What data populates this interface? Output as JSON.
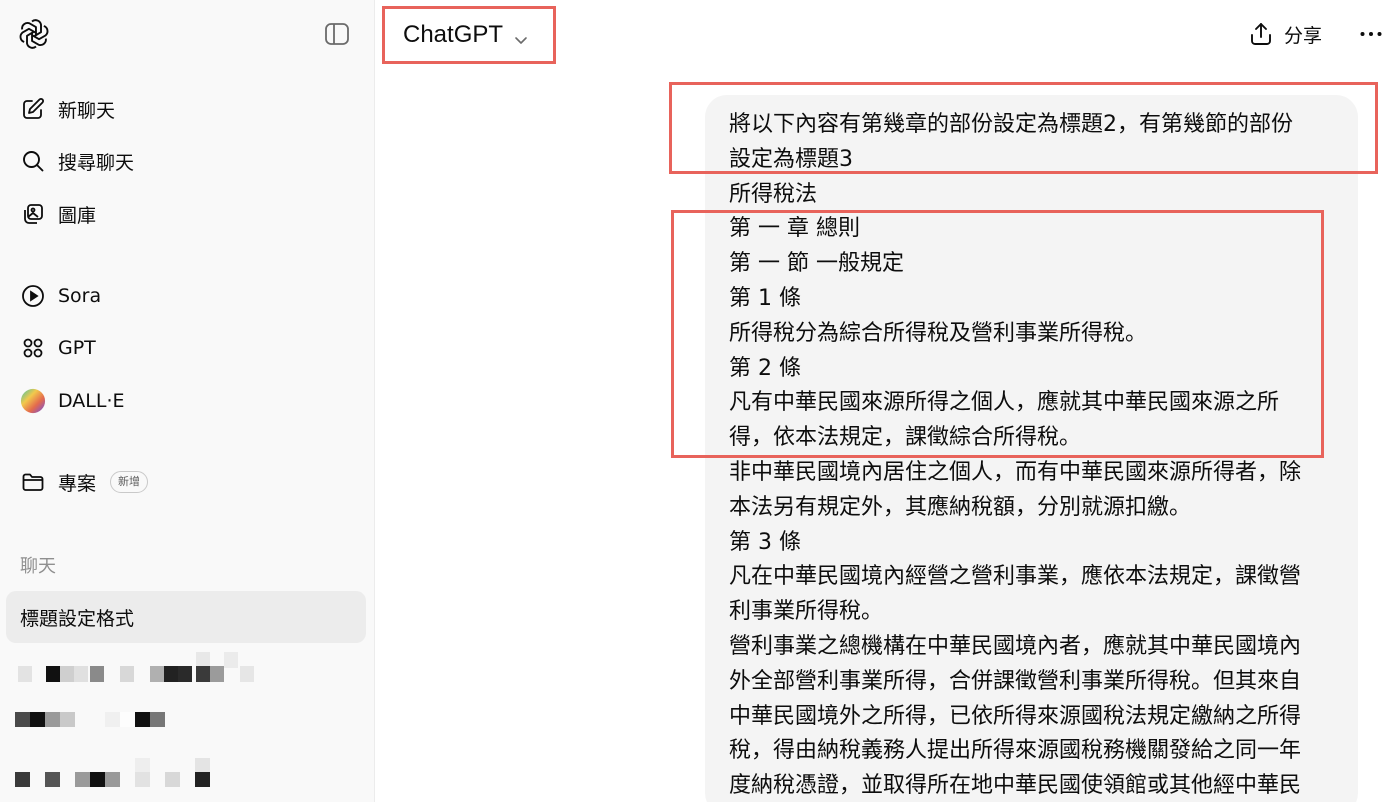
{
  "sidebar": {
    "logo": "openai-logo",
    "toggle_icon": "sidebar-toggle-icon",
    "nav": [
      {
        "label": "新聊天",
        "icon": "edit-icon"
      },
      {
        "label": "搜尋聊天",
        "icon": "search-icon"
      },
      {
        "label": "圖庫",
        "icon": "gallery-icon"
      },
      {
        "label": "Sora",
        "icon": "play-icon"
      },
      {
        "label": "GPT",
        "icon": "grid-icon"
      },
      {
        "label": "DALL·E",
        "icon": "dalle-icon"
      },
      {
        "label": "專案",
        "icon": "folder-icon",
        "badge": "新增"
      }
    ],
    "section_label": "聊天",
    "active_chat": "標題設定格式"
  },
  "header": {
    "model_label": "ChatGPT",
    "share_label": "分享"
  },
  "message": {
    "lines": [
      "將以下內容有第幾章的部份設定為標題2，有第幾節的部份",
      "設定為標題3",
      "所得稅法",
      "第 一 章 總則",
      "第 一 節 一般規定",
      "第 1 條",
      "所得稅分為綜合所得稅及營利事業所得稅。",
      "第 2 條",
      "凡有中華民國來源所得之個人，應就其中華民國來源之所",
      "得，依本法規定，課徵綜合所得稅。",
      "非中華民國境內居住之個人，而有中華民國來源所得者，除",
      "本法另有規定外，其應納稅額，分別就源扣繳。",
      "第 3 條",
      "凡在中華民國境內經營之營利事業，應依本法規定，課徵營",
      "利事業所得稅。",
      "營利事業之總機構在中華民國境內者，應就其中華民國境內",
      "外全部營利事業所得，合併課徵營利事業所得稅。但其來自",
      "中華民國境外之所得，已依所得來源國稅法規定繳納之所得",
      "稅，得由納稅義務人提出所得來源國稅務機關發給之同一年",
      "度納稅憑證，並取得所在地中華民國使領館或其他經中華民"
    ]
  },
  "colors": {
    "highlight": "#e8635b",
    "sidebar_bg": "#f9f9f9",
    "bubble_bg": "#f4f4f4",
    "active_chat_bg": "#ececec"
  }
}
